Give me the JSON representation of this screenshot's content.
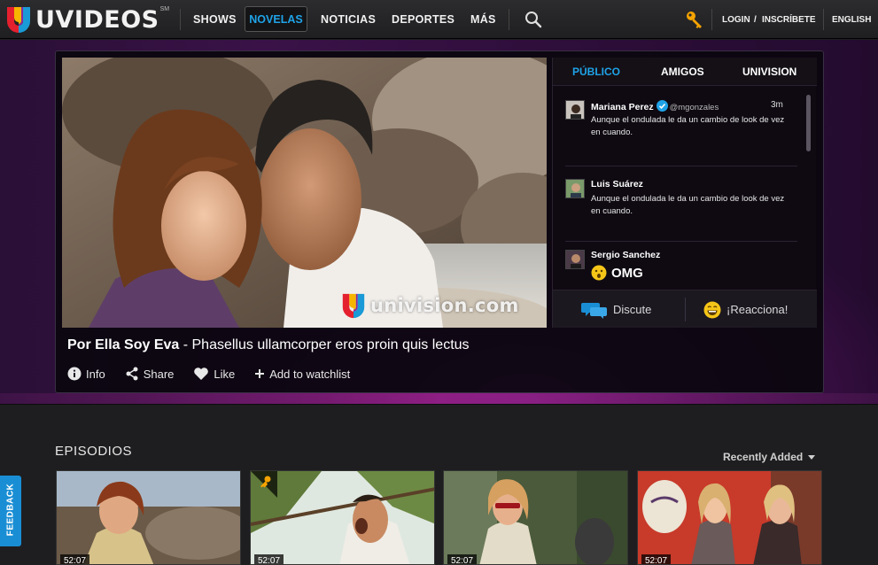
{
  "app": {
    "logo_text": "UVIDEOS",
    "logo_sm": "SM"
  },
  "nav": {
    "items": [
      "SHOWS",
      "NOVELAS",
      "NOTICIAS",
      "DEPORTES",
      "MÁS"
    ],
    "active": "NOVELAS",
    "login": "LOGIN",
    "slash": "/",
    "register": "INSCRÍBETE",
    "language": "ENGLISH"
  },
  "video": {
    "watermark": "univision.com",
    "show_name": "Por Ella Soy Eva",
    "separator": " - ",
    "episode_title": "Phasellus ullamcorper eros proin quis lectus"
  },
  "actions": {
    "info": "Info",
    "share": "Share",
    "like": "Like",
    "watchlist": "Add to watchlist"
  },
  "social": {
    "tabs": [
      "PÚBLICO",
      "AMIGOS",
      "UNIVISION"
    ],
    "active_tab": "PÚBLICO",
    "posts": [
      {
        "name": "Mariana Perez",
        "handle": "@mgonzales",
        "time": "3m",
        "text": "Aunque el ondulada le da un cambio de look de vez en cuando."
      },
      {
        "name": "Luis Suárez",
        "handle": "",
        "time": "",
        "text": "Aunque el ondulada le da un cambio de look de vez en cuando."
      },
      {
        "name": "Sergio Sanchez",
        "handle": "",
        "time": "",
        "text": "OMG"
      }
    ],
    "discuss": "Discute",
    "react": "¡Reacciona!"
  },
  "episodes": {
    "title": "EPISODIOS",
    "sort_label": "Recently Added",
    "items": [
      {
        "duration": "52:07",
        "premium": false
      },
      {
        "duration": "52:07",
        "premium": true
      },
      {
        "duration": "52:07",
        "premium": false
      },
      {
        "duration": "52:07",
        "premium": false
      }
    ]
  },
  "feedback": "FEEDBACK",
  "colors": {
    "accent": "#1fa3e8",
    "key": "#f5a300",
    "band": "#3a1248"
  }
}
